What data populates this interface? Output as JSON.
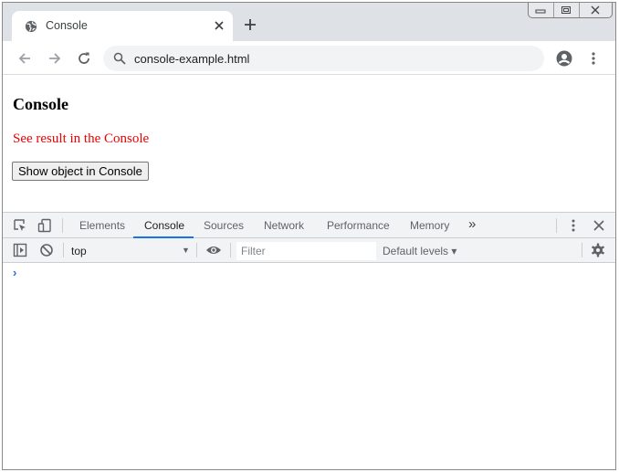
{
  "browser": {
    "tab": {
      "title": "Console"
    },
    "address": {
      "url": "console-example.html"
    }
  },
  "page": {
    "heading": "Console",
    "note": "See result in the Console",
    "button_label": "Show object in Console"
  },
  "devtools": {
    "tabs": [
      {
        "label": "Elements"
      },
      {
        "label": "Console"
      },
      {
        "label": "Sources"
      },
      {
        "label": "Network"
      },
      {
        "label": "Performance"
      },
      {
        "label": "Memory"
      }
    ],
    "more_tabs": "»",
    "active_tab": "Console",
    "context": "top",
    "filter": {
      "placeholder": "Filter",
      "value": ""
    },
    "levels": "Default levels ▾",
    "prompt": "›"
  },
  "colors": {
    "accent": "#1a73e8",
    "note_red": "#ee0000"
  }
}
